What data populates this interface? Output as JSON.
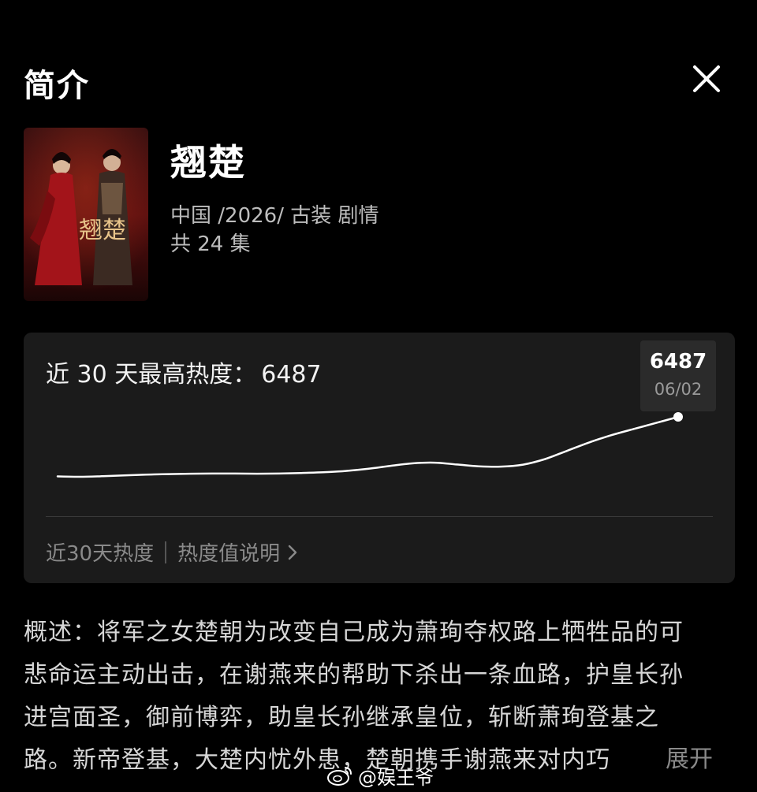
{
  "header": {
    "title": "简介",
    "close_icon": "close-icon"
  },
  "show": {
    "title": "翘楚",
    "meta_line": "中国 /2026/ 古装 剧情",
    "episodes": "共 24 集",
    "poster_text": "翘楚"
  },
  "heat": {
    "peak_label": "近 30 天最高热度：",
    "peak_value": "6487",
    "tooltip_value": "6487",
    "tooltip_date": "06/02",
    "footer_left": "近30天热度",
    "footer_right": "热度值说明",
    "chevron_icon": "chevron-right-icon"
  },
  "chart_data": {
    "type": "line",
    "title": "",
    "xlabel": "",
    "ylabel": "",
    "grid": false,
    "series": [
      {
        "values": [
          3200,
          3180,
          3210,
          3260,
          3300,
          3330,
          3350,
          3360,
          3360,
          3350,
          3360,
          3390,
          3430,
          3500,
          3620,
          3780,
          3920,
          3960,
          3860,
          3760,
          3740,
          3850,
          4160,
          4620,
          5080,
          5480,
          5820,
          6150,
          6487
        ]
      }
    ],
    "highlight": {
      "label": "06/02",
      "value": 6487
    }
  },
  "synopsis": {
    "lines": [
      "概述：将军之女楚朝为改变自己成为萧珣夺权路上牺牲品的可",
      "悲命运主动出击，在谢燕来的帮助下杀出一条血路，护皇长孙",
      "进宫面圣，御前博弈，助皇长孙继承皇位，斩断萧珣登基之",
      "路。新帝登基，大楚内忧外患，楚朝携手谢燕来对内巧"
    ],
    "expand_label": "展开"
  },
  "watermark": {
    "text": "@娱王爷",
    "icon": "weibo-icon"
  }
}
